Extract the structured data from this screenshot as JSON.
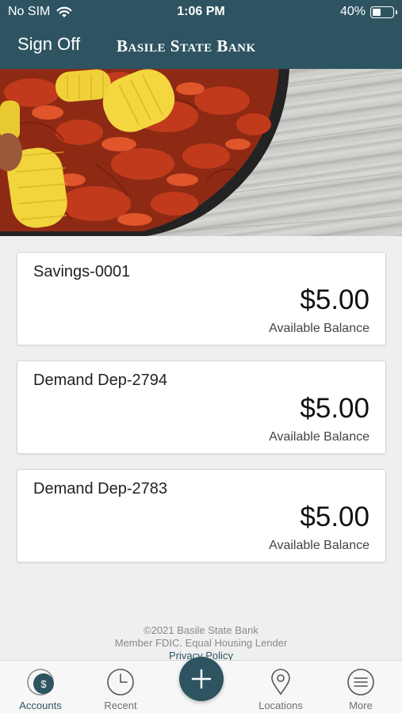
{
  "status_bar": {
    "carrier": "No SIM",
    "time": "1:06 PM",
    "battery_percent": "40%",
    "battery_level": 0.4
  },
  "nav": {
    "sign_off_label": "Sign Off",
    "bank_title": "Basile State Bank"
  },
  "accounts": [
    {
      "name": "Savings-0001",
      "amount": "$5.00",
      "label": "Available Balance"
    },
    {
      "name": "Demand Dep-2794",
      "amount": "$5.00",
      "label": "Available Balance"
    },
    {
      "name": "Demand Dep-2783",
      "amount": "$5.00",
      "label": "Available Balance"
    }
  ],
  "footer": {
    "copyright": "©2021 Basile State Bank",
    "fdic": "Member FDIC. Equal Housing Lender",
    "privacy": "Privacy Policy"
  },
  "tabbar": {
    "accounts_label": "Accounts",
    "recent_label": "Recent",
    "locations_label": "Locations",
    "more_label": "More",
    "icons": {
      "accounts": "dollar-circle-icon",
      "recent": "clock-icon",
      "add": "plus-icon",
      "locations": "map-pin-icon",
      "more": "menu-lines-icon"
    }
  },
  "colors": {
    "brand": "#2e5462",
    "background": "#efefef",
    "card": "#ffffff"
  }
}
